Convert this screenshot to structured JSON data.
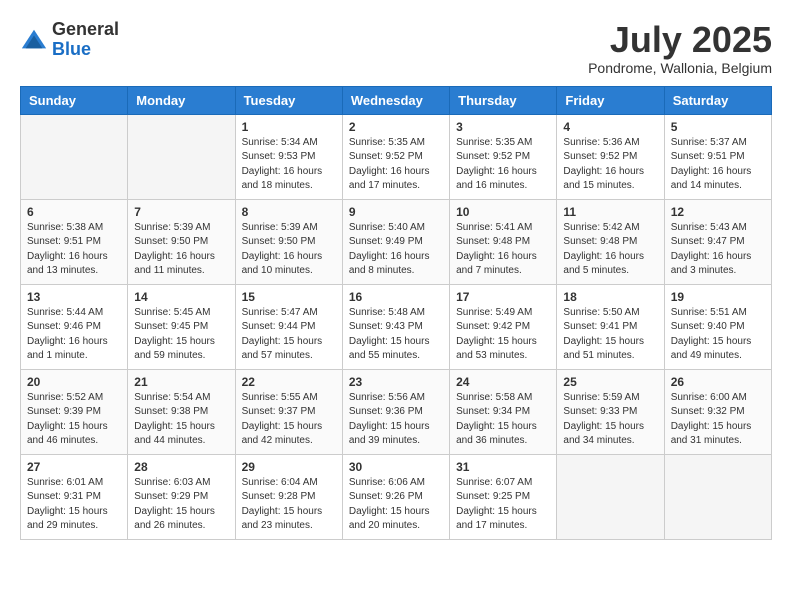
{
  "header": {
    "logo_general": "General",
    "logo_blue": "Blue",
    "month_title": "July 2025",
    "location": "Pondrome, Wallonia, Belgium"
  },
  "days_of_week": [
    "Sunday",
    "Monday",
    "Tuesday",
    "Wednesday",
    "Thursday",
    "Friday",
    "Saturday"
  ],
  "weeks": [
    [
      {
        "num": "",
        "info": ""
      },
      {
        "num": "",
        "info": ""
      },
      {
        "num": "1",
        "info": "Sunrise: 5:34 AM\nSunset: 9:53 PM\nDaylight: 16 hours and 18 minutes."
      },
      {
        "num": "2",
        "info": "Sunrise: 5:35 AM\nSunset: 9:52 PM\nDaylight: 16 hours and 17 minutes."
      },
      {
        "num": "3",
        "info": "Sunrise: 5:35 AM\nSunset: 9:52 PM\nDaylight: 16 hours and 16 minutes."
      },
      {
        "num": "4",
        "info": "Sunrise: 5:36 AM\nSunset: 9:52 PM\nDaylight: 16 hours and 15 minutes."
      },
      {
        "num": "5",
        "info": "Sunrise: 5:37 AM\nSunset: 9:51 PM\nDaylight: 16 hours and 14 minutes."
      }
    ],
    [
      {
        "num": "6",
        "info": "Sunrise: 5:38 AM\nSunset: 9:51 PM\nDaylight: 16 hours and 13 minutes."
      },
      {
        "num": "7",
        "info": "Sunrise: 5:39 AM\nSunset: 9:50 PM\nDaylight: 16 hours and 11 minutes."
      },
      {
        "num": "8",
        "info": "Sunrise: 5:39 AM\nSunset: 9:50 PM\nDaylight: 16 hours and 10 minutes."
      },
      {
        "num": "9",
        "info": "Sunrise: 5:40 AM\nSunset: 9:49 PM\nDaylight: 16 hours and 8 minutes."
      },
      {
        "num": "10",
        "info": "Sunrise: 5:41 AM\nSunset: 9:48 PM\nDaylight: 16 hours and 7 minutes."
      },
      {
        "num": "11",
        "info": "Sunrise: 5:42 AM\nSunset: 9:48 PM\nDaylight: 16 hours and 5 minutes."
      },
      {
        "num": "12",
        "info": "Sunrise: 5:43 AM\nSunset: 9:47 PM\nDaylight: 16 hours and 3 minutes."
      }
    ],
    [
      {
        "num": "13",
        "info": "Sunrise: 5:44 AM\nSunset: 9:46 PM\nDaylight: 16 hours and 1 minute."
      },
      {
        "num": "14",
        "info": "Sunrise: 5:45 AM\nSunset: 9:45 PM\nDaylight: 15 hours and 59 minutes."
      },
      {
        "num": "15",
        "info": "Sunrise: 5:47 AM\nSunset: 9:44 PM\nDaylight: 15 hours and 57 minutes."
      },
      {
        "num": "16",
        "info": "Sunrise: 5:48 AM\nSunset: 9:43 PM\nDaylight: 15 hours and 55 minutes."
      },
      {
        "num": "17",
        "info": "Sunrise: 5:49 AM\nSunset: 9:42 PM\nDaylight: 15 hours and 53 minutes."
      },
      {
        "num": "18",
        "info": "Sunrise: 5:50 AM\nSunset: 9:41 PM\nDaylight: 15 hours and 51 minutes."
      },
      {
        "num": "19",
        "info": "Sunrise: 5:51 AM\nSunset: 9:40 PM\nDaylight: 15 hours and 49 minutes."
      }
    ],
    [
      {
        "num": "20",
        "info": "Sunrise: 5:52 AM\nSunset: 9:39 PM\nDaylight: 15 hours and 46 minutes."
      },
      {
        "num": "21",
        "info": "Sunrise: 5:54 AM\nSunset: 9:38 PM\nDaylight: 15 hours and 44 minutes."
      },
      {
        "num": "22",
        "info": "Sunrise: 5:55 AM\nSunset: 9:37 PM\nDaylight: 15 hours and 42 minutes."
      },
      {
        "num": "23",
        "info": "Sunrise: 5:56 AM\nSunset: 9:36 PM\nDaylight: 15 hours and 39 minutes."
      },
      {
        "num": "24",
        "info": "Sunrise: 5:58 AM\nSunset: 9:34 PM\nDaylight: 15 hours and 36 minutes."
      },
      {
        "num": "25",
        "info": "Sunrise: 5:59 AM\nSunset: 9:33 PM\nDaylight: 15 hours and 34 minutes."
      },
      {
        "num": "26",
        "info": "Sunrise: 6:00 AM\nSunset: 9:32 PM\nDaylight: 15 hours and 31 minutes."
      }
    ],
    [
      {
        "num": "27",
        "info": "Sunrise: 6:01 AM\nSunset: 9:31 PM\nDaylight: 15 hours and 29 minutes."
      },
      {
        "num": "28",
        "info": "Sunrise: 6:03 AM\nSunset: 9:29 PM\nDaylight: 15 hours and 26 minutes."
      },
      {
        "num": "29",
        "info": "Sunrise: 6:04 AM\nSunset: 9:28 PM\nDaylight: 15 hours and 23 minutes."
      },
      {
        "num": "30",
        "info": "Sunrise: 6:06 AM\nSunset: 9:26 PM\nDaylight: 15 hours and 20 minutes."
      },
      {
        "num": "31",
        "info": "Sunrise: 6:07 AM\nSunset: 9:25 PM\nDaylight: 15 hours and 17 minutes."
      },
      {
        "num": "",
        "info": ""
      },
      {
        "num": "",
        "info": ""
      }
    ]
  ]
}
